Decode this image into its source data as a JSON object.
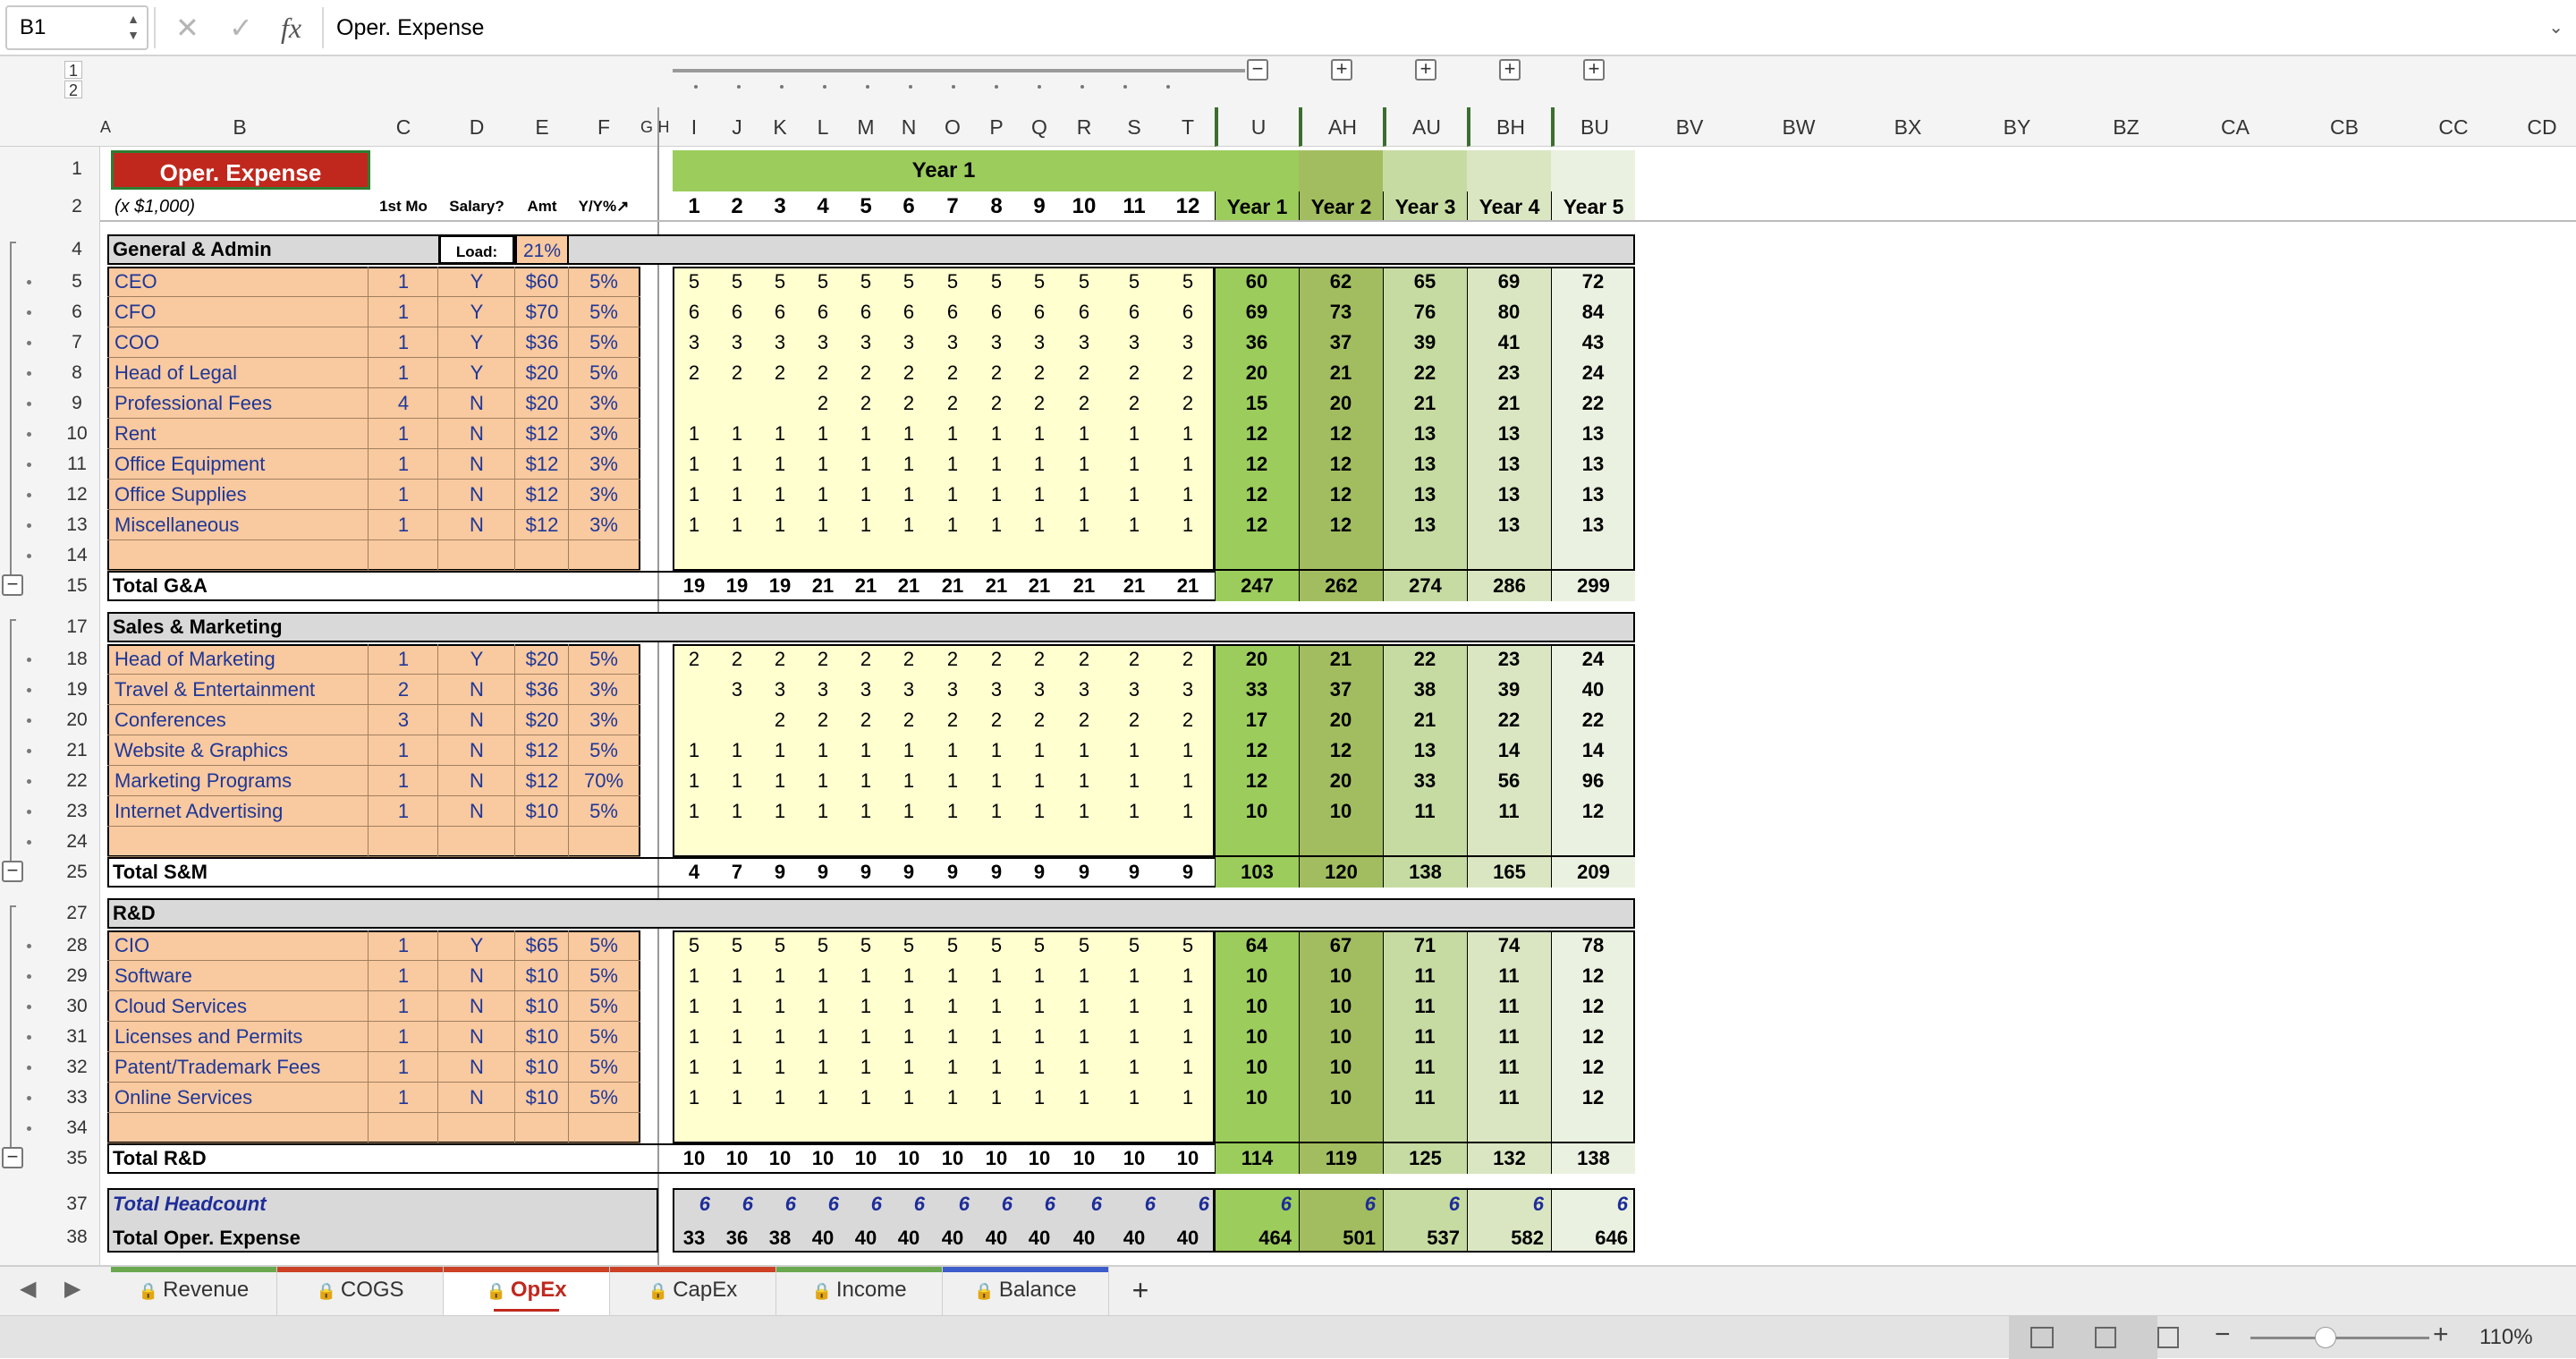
{
  "formula_bar": {
    "cell_ref": "B1",
    "formula": "Oper. Expense",
    "cancel_glyph": "✕",
    "enter_glyph": "✓",
    "fx_glyph": "fx"
  },
  "outline_levels": [
    "1",
    "2"
  ],
  "columns": [
    "A",
    "B",
    "C",
    "D",
    "E",
    "F",
    "G",
    "H",
    "I",
    "J",
    "K",
    "L",
    "M",
    "N",
    "O",
    "P",
    "Q",
    "R",
    "S",
    "T",
    "U",
    "AH",
    "AU",
    "BH",
    "BU",
    "BV",
    "BW",
    "BX",
    "BY",
    "BZ",
    "CA",
    "CB",
    "CC",
    "CD"
  ],
  "rows": [
    "1",
    "2",
    "4",
    "5",
    "6",
    "7",
    "8",
    "9",
    "10",
    "11",
    "12",
    "13",
    "14",
    "15",
    "17",
    "18",
    "19",
    "20",
    "21",
    "22",
    "23",
    "24",
    "25",
    "27",
    "28",
    "29",
    "30",
    "31",
    "32",
    "33",
    "34",
    "35",
    "37",
    "38"
  ],
  "title": "Oper. Expense",
  "units": "(x $1,000)",
  "year1_banner": "Year 1",
  "hdr": {
    "first_mo": "1st Mo",
    "salary": "Salary?",
    "amt": "Amt",
    "yy": "Y/Y%↗"
  },
  "months": [
    "1",
    "2",
    "3",
    "4",
    "5",
    "6",
    "7",
    "8",
    "9",
    "10",
    "11",
    "12"
  ],
  "years": [
    "Year 1",
    "Year 2",
    "Year 3",
    "Year 4",
    "Year 5"
  ],
  "load": {
    "label": "Load:",
    "value": "21%"
  },
  "sections": [
    {
      "title": "General & Admin",
      "items": [
        {
          "name": "CEO",
          "c": "1",
          "d": "Y",
          "e": "$60",
          "f": "5%",
          "m": [
            "5",
            "5",
            "5",
            "5",
            "5",
            "5",
            "5",
            "5",
            "5",
            "5",
            "5",
            "5"
          ],
          "y": [
            "60",
            "62",
            "65",
            "69",
            "72"
          ]
        },
        {
          "name": "CFO",
          "c": "1",
          "d": "Y",
          "e": "$70",
          "f": "5%",
          "m": [
            "6",
            "6",
            "6",
            "6",
            "6",
            "6",
            "6",
            "6",
            "6",
            "6",
            "6",
            "6"
          ],
          "y": [
            "69",
            "73",
            "76",
            "80",
            "84"
          ]
        },
        {
          "name": "COO",
          "c": "1",
          "d": "Y",
          "e": "$36",
          "f": "5%",
          "m": [
            "3",
            "3",
            "3",
            "3",
            "3",
            "3",
            "3",
            "3",
            "3",
            "3",
            "3",
            "3"
          ],
          "y": [
            "36",
            "37",
            "39",
            "41",
            "43"
          ]
        },
        {
          "name": "Head of Legal",
          "c": "1",
          "d": "Y",
          "e": "$20",
          "f": "5%",
          "m": [
            "2",
            "2",
            "2",
            "2",
            "2",
            "2",
            "2",
            "2",
            "2",
            "2",
            "2",
            "2"
          ],
          "y": [
            "20",
            "21",
            "22",
            "23",
            "24"
          ]
        },
        {
          "name": "Professional Fees",
          "c": "4",
          "d": "N",
          "e": "$20",
          "f": "3%",
          "m": [
            "",
            "",
            "",
            "2",
            "2",
            "2",
            "2",
            "2",
            "2",
            "2",
            "2",
            "2"
          ],
          "y": [
            "15",
            "20",
            "21",
            "21",
            "22"
          ]
        },
        {
          "name": "Rent",
          "c": "1",
          "d": "N",
          "e": "$12",
          "f": "3%",
          "m": [
            "1",
            "1",
            "1",
            "1",
            "1",
            "1",
            "1",
            "1",
            "1",
            "1",
            "1",
            "1"
          ],
          "y": [
            "12",
            "12",
            "13",
            "13",
            "13"
          ]
        },
        {
          "name": "Office Equipment",
          "c": "1",
          "d": "N",
          "e": "$12",
          "f": "3%",
          "m": [
            "1",
            "1",
            "1",
            "1",
            "1",
            "1",
            "1",
            "1",
            "1",
            "1",
            "1",
            "1"
          ],
          "y": [
            "12",
            "12",
            "13",
            "13",
            "13"
          ]
        },
        {
          "name": "Office Supplies",
          "c": "1",
          "d": "N",
          "e": "$12",
          "f": "3%",
          "m": [
            "1",
            "1",
            "1",
            "1",
            "1",
            "1",
            "1",
            "1",
            "1",
            "1",
            "1",
            "1"
          ],
          "y": [
            "12",
            "12",
            "13",
            "13",
            "13"
          ]
        },
        {
          "name": "Miscellaneous",
          "c": "1",
          "d": "N",
          "e": "$12",
          "f": "3%",
          "m": [
            "1",
            "1",
            "1",
            "1",
            "1",
            "1",
            "1",
            "1",
            "1",
            "1",
            "1",
            "1"
          ],
          "y": [
            "12",
            "12",
            "13",
            "13",
            "13"
          ]
        }
      ],
      "total": {
        "label": "Total G&A",
        "m": [
          "19",
          "19",
          "19",
          "21",
          "21",
          "21",
          "21",
          "21",
          "21",
          "21",
          "21",
          "21"
        ],
        "y": [
          "247",
          "262",
          "274",
          "286",
          "299"
        ]
      }
    },
    {
      "title": "Sales & Marketing",
      "items": [
        {
          "name": "Head of Marketing",
          "c": "1",
          "d": "Y",
          "e": "$20",
          "f": "5%",
          "m": [
            "2",
            "2",
            "2",
            "2",
            "2",
            "2",
            "2",
            "2",
            "2",
            "2",
            "2",
            "2"
          ],
          "y": [
            "20",
            "21",
            "22",
            "23",
            "24"
          ]
        },
        {
          "name": "Travel & Entertainment",
          "c": "2",
          "d": "N",
          "e": "$36",
          "f": "3%",
          "m": [
            "",
            "3",
            "3",
            "3",
            "3",
            "3",
            "3",
            "3",
            "3",
            "3",
            "3",
            "3"
          ],
          "y": [
            "33",
            "37",
            "38",
            "39",
            "40"
          ]
        },
        {
          "name": "Conferences",
          "c": "3",
          "d": "N",
          "e": "$20",
          "f": "3%",
          "m": [
            "",
            "",
            "2",
            "2",
            "2",
            "2",
            "2",
            "2",
            "2",
            "2",
            "2",
            "2"
          ],
          "y": [
            "17",
            "20",
            "21",
            "22",
            "22"
          ]
        },
        {
          "name": "Website  & Graphics",
          "c": "1",
          "d": "N",
          "e": "$12",
          "f": "5%",
          "m": [
            "1",
            "1",
            "1",
            "1",
            "1",
            "1",
            "1",
            "1",
            "1",
            "1",
            "1",
            "1"
          ],
          "y": [
            "12",
            "12",
            "13",
            "14",
            "14"
          ]
        },
        {
          "name": "Marketing Programs",
          "c": "1",
          "d": "N",
          "e": "$12",
          "f": "70%",
          "m": [
            "1",
            "1",
            "1",
            "1",
            "1",
            "1",
            "1",
            "1",
            "1",
            "1",
            "1",
            "1"
          ],
          "y": [
            "12",
            "20",
            "33",
            "56",
            "96"
          ]
        },
        {
          "name": "Internet Advertising",
          "c": "1",
          "d": "N",
          "e": "$10",
          "f": "5%",
          "m": [
            "1",
            "1",
            "1",
            "1",
            "1",
            "1",
            "1",
            "1",
            "1",
            "1",
            "1",
            "1"
          ],
          "y": [
            "10",
            "10",
            "11",
            "11",
            "12"
          ]
        }
      ],
      "total": {
        "label": "Total S&M",
        "m": [
          "4",
          "7",
          "9",
          "9",
          "9",
          "9",
          "9",
          "9",
          "9",
          "9",
          "9",
          "9"
        ],
        "y": [
          "103",
          "120",
          "138",
          "165",
          "209"
        ]
      }
    },
    {
      "title": "R&D",
      "items": [
        {
          "name": "CIO",
          "c": "1",
          "d": "Y",
          "e": "$65",
          "f": "5%",
          "m": [
            "5",
            "5",
            "5",
            "5",
            "5",
            "5",
            "5",
            "5",
            "5",
            "5",
            "5",
            "5"
          ],
          "y": [
            "64",
            "67",
            "71",
            "74",
            "78"
          ]
        },
        {
          "name": "Software",
          "c": "1",
          "d": "N",
          "e": "$10",
          "f": "5%",
          "m": [
            "1",
            "1",
            "1",
            "1",
            "1",
            "1",
            "1",
            "1",
            "1",
            "1",
            "1",
            "1"
          ],
          "y": [
            "10",
            "10",
            "11",
            "11",
            "12"
          ]
        },
        {
          "name": "Cloud Services",
          "c": "1",
          "d": "N",
          "e": "$10",
          "f": "5%",
          "m": [
            "1",
            "1",
            "1",
            "1",
            "1",
            "1",
            "1",
            "1",
            "1",
            "1",
            "1",
            "1"
          ],
          "y": [
            "10",
            "10",
            "11",
            "11",
            "12"
          ]
        },
        {
          "name": "Licenses and Permits",
          "c": "1",
          "d": "N",
          "e": "$10",
          "f": "5%",
          "m": [
            "1",
            "1",
            "1",
            "1",
            "1",
            "1",
            "1",
            "1",
            "1",
            "1",
            "1",
            "1"
          ],
          "y": [
            "10",
            "10",
            "11",
            "11",
            "12"
          ]
        },
        {
          "name": "Patent/Trademark Fees",
          "c": "1",
          "d": "N",
          "e": "$10",
          "f": "5%",
          "m": [
            "1",
            "1",
            "1",
            "1",
            "1",
            "1",
            "1",
            "1",
            "1",
            "1",
            "1",
            "1"
          ],
          "y": [
            "10",
            "10",
            "11",
            "11",
            "12"
          ]
        },
        {
          "name": "Online Services",
          "c": "1",
          "d": "N",
          "e": "$10",
          "f": "5%",
          "m": [
            "1",
            "1",
            "1",
            "1",
            "1",
            "1",
            "1",
            "1",
            "1",
            "1",
            "1",
            "1"
          ],
          "y": [
            "10",
            "10",
            "11",
            "11",
            "12"
          ]
        }
      ],
      "total": {
        "label": "Total R&D",
        "m": [
          "10",
          "10",
          "10",
          "10",
          "10",
          "10",
          "10",
          "10",
          "10",
          "10",
          "10",
          "10"
        ],
        "y": [
          "114",
          "119",
          "125",
          "132",
          "138"
        ]
      }
    }
  ],
  "headcount": {
    "label": "Total Headcount",
    "m": [
      "6",
      "6",
      "6",
      "6",
      "6",
      "6",
      "6",
      "6",
      "6",
      "6",
      "6",
      "6"
    ],
    "y": [
      "6",
      "6",
      "6",
      "6",
      "6"
    ]
  },
  "opex_total": {
    "label": "Total Oper. Expense",
    "m": [
      "33",
      "36",
      "38",
      "40",
      "40",
      "40",
      "40",
      "40",
      "40",
      "40",
      "40",
      "40"
    ],
    "y": [
      "464",
      "501",
      "537",
      "582",
      "646"
    ]
  },
  "sheet_tabs": [
    {
      "label": "Revenue",
      "color": "#6aa84f",
      "active": false
    },
    {
      "label": "COGS",
      "color": "#cc4125",
      "active": false
    },
    {
      "label": "OpEx",
      "color": "#cc4125",
      "active": true
    },
    {
      "label": "CapEx",
      "color": "#cc4125",
      "active": false
    },
    {
      "label": "Income",
      "color": "#6aa84f",
      "active": false
    },
    {
      "label": "Balance",
      "color": "#3d5ccc",
      "active": false
    }
  ],
  "add_sheet": "+",
  "zoom": "110%",
  "zoom_fraction": 0.42,
  "colors": {
    "header_red": "#c0281e",
    "label_orange": "#f9c99f",
    "label_text": "#1e3799",
    "month_fill": "#ffffd0",
    "year1_green": "#9ccc5c",
    "year2_green": "#a2bd60",
    "year3_green": "#c6dba2",
    "year4_green": "#dae6c2",
    "year5_green": "#eaf1e0",
    "section_gray": "#d9d9d9",
    "headcount_blue": "#1e2d99"
  }
}
